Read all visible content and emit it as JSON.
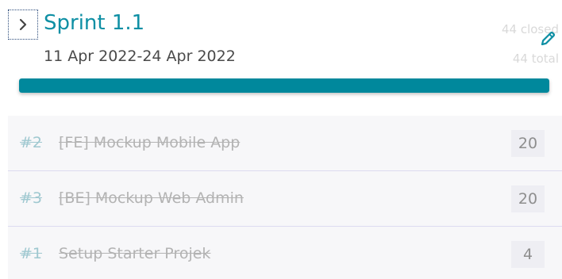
{
  "sprint": {
    "title": "Sprint 1.1",
    "dates": "11 Apr 2022-24 Apr 2022",
    "closed_label": "44 closed",
    "total_label": "44 total",
    "progress": 1.0,
    "progress_color": "#00889c",
    "title_color": "#0e8fa4"
  },
  "icons": {
    "toggle": "chevron-right-icon",
    "edit": "pencil-icon"
  },
  "tasks": [
    {
      "id": "#2",
      "name": "[FE] Mockup Mobile App",
      "points": "20"
    },
    {
      "id": "#3",
      "name": "[BE] Mockup Web Admin",
      "points": "20"
    },
    {
      "id": "#1",
      "name": "Setup Starter Projek",
      "points": "4"
    }
  ]
}
